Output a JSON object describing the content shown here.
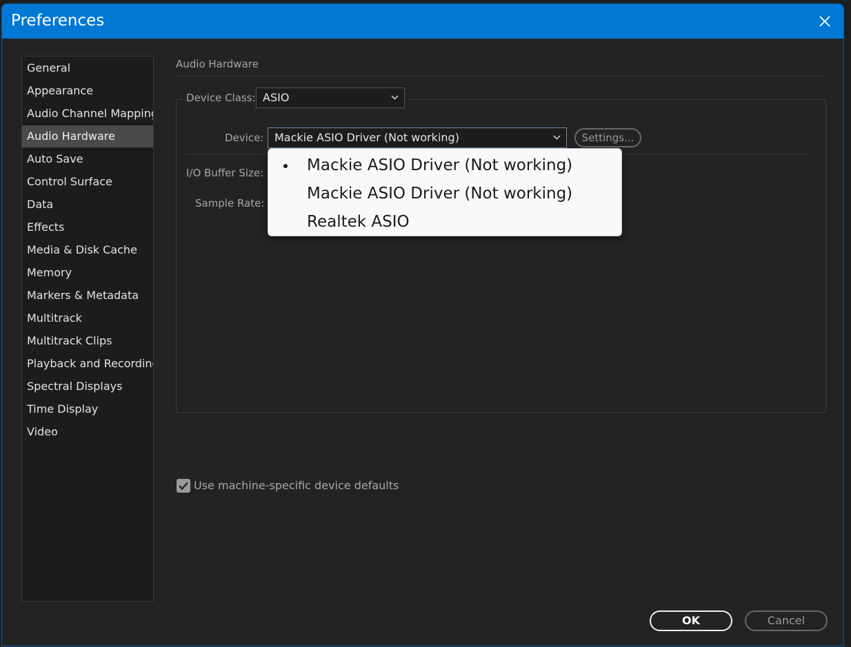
{
  "window": {
    "title": "Preferences"
  },
  "sidebar": {
    "items": [
      {
        "label": "General"
      },
      {
        "label": "Appearance"
      },
      {
        "label": "Audio Channel Mapping"
      },
      {
        "label": "Audio Hardware",
        "active": true
      },
      {
        "label": "Auto Save"
      },
      {
        "label": "Control Surface"
      },
      {
        "label": "Data"
      },
      {
        "label": "Effects"
      },
      {
        "label": "Media & Disk Cache"
      },
      {
        "label": "Memory"
      },
      {
        "label": "Markers & Metadata"
      },
      {
        "label": "Multitrack"
      },
      {
        "label": "Multitrack Clips"
      },
      {
        "label": "Playback and Recording"
      },
      {
        "label": "Spectral Displays"
      },
      {
        "label": "Time Display"
      },
      {
        "label": "Video"
      }
    ]
  },
  "main": {
    "section_title": "Audio Hardware",
    "device_class": {
      "label": "Device Class:",
      "value": "ASIO"
    },
    "device": {
      "label": "Device:",
      "value": "Mackie ASIO Driver (Not working)",
      "settings_label": "Settings..."
    },
    "io_buffer_label": "I/O Buffer Size:",
    "sample_rate_label": "Sample Rate:",
    "dropdown": {
      "options": [
        {
          "label": "Mackie ASIO Driver (Not working)",
          "selected": true
        },
        {
          "label": "Mackie ASIO Driver (Not working)",
          "selected": false
        },
        {
          "label": "Realtek ASIO",
          "selected": false
        }
      ]
    },
    "machine_defaults": {
      "label": "Use machine-specific device defaults",
      "checked": true
    }
  },
  "footer": {
    "ok_label": "OK",
    "cancel_label": "Cancel"
  },
  "colors": {
    "titlebar": "#0078d4",
    "active_item": "#4a4a4a",
    "background": "#232323"
  }
}
